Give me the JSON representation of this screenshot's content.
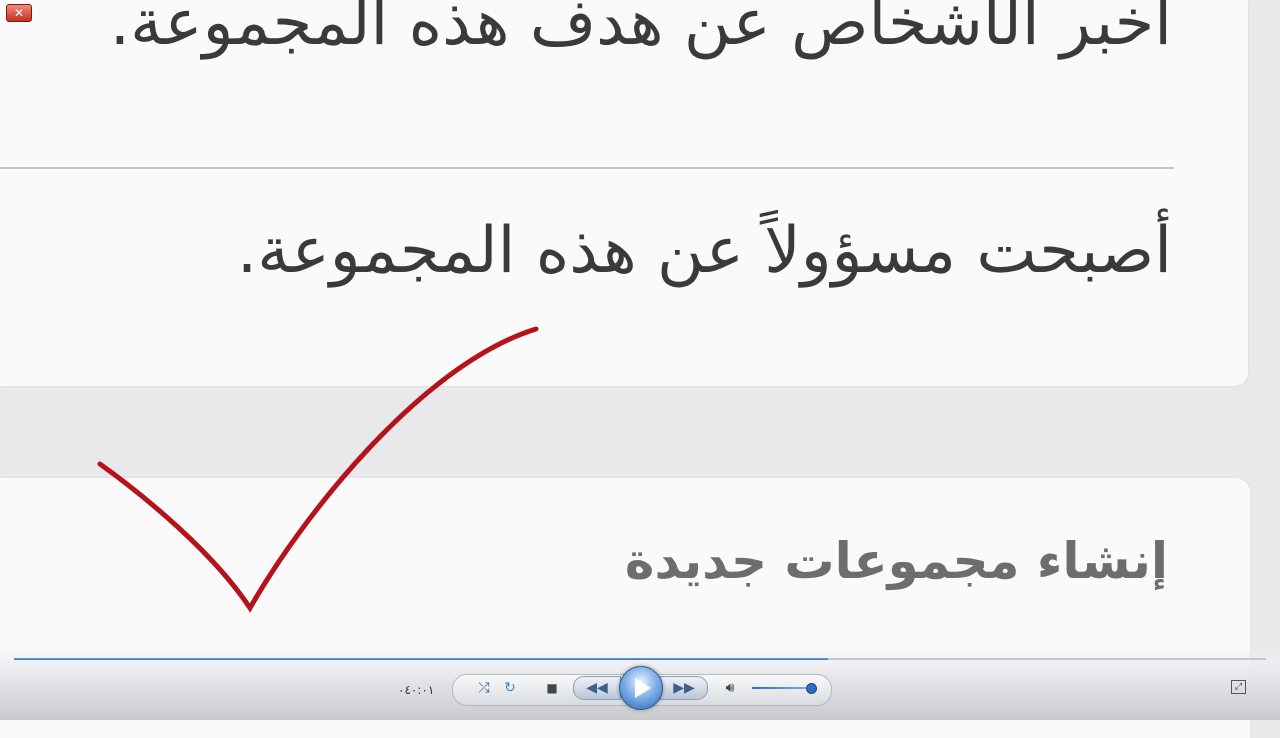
{
  "window": {
    "close_label": "✕"
  },
  "content": {
    "lines": [
      "أخبر الأشخاص عن هدف هذه المجموعة.",
      "أصبحت مسؤولاً عن هذه المجموعة.",
      "إنشاء مجموعات جديدة"
    ]
  },
  "annotation": {
    "checkmark_color": "#b5121b"
  },
  "player": {
    "time": "٠٤٠:٠١",
    "seek_progress": 0.65,
    "volume_level": 0.9,
    "icons": {
      "shuffle": "shuffle-icon",
      "repeat": "repeat-icon",
      "stop": "stop-icon",
      "previous": "previous-icon",
      "play": "play-icon",
      "next": "next-icon",
      "volume": "volume-icon",
      "fullscreen": "fullscreen-icon"
    },
    "accent_color": "#2b6fc1"
  }
}
